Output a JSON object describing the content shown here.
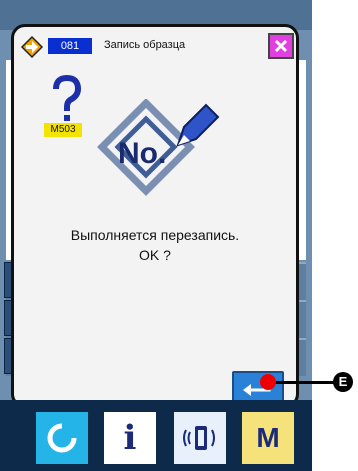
{
  "dialog": {
    "program_number": "081",
    "title": "Запись образца",
    "message_code": "M503",
    "message_line1": "Выполняется перезапись.",
    "message_line2": "OK ?"
  },
  "callout": {
    "marker": "E"
  },
  "bottom_bar": {
    "info_label": "i",
    "mode_label": "M"
  },
  "icons": {
    "arrow": "arrow-right-icon",
    "close": "close-icon",
    "question": "question-icon",
    "no": "number-pencil-icon",
    "enter": "enter-icon",
    "reset": "reset-icon",
    "communication": "communication-icon"
  },
  "colors": {
    "dialog_bg": "#f3f3f3",
    "program_badge": "#0a2fd0",
    "close_button": "#e040e0",
    "code_badge": "#f2e400",
    "enter_button": "#2a82d8",
    "callout_dot": "#ee0000",
    "bottom_bar": "#0d2a4a",
    "reset_button": "#24b4e8",
    "mode_button": "#f5e27a"
  }
}
